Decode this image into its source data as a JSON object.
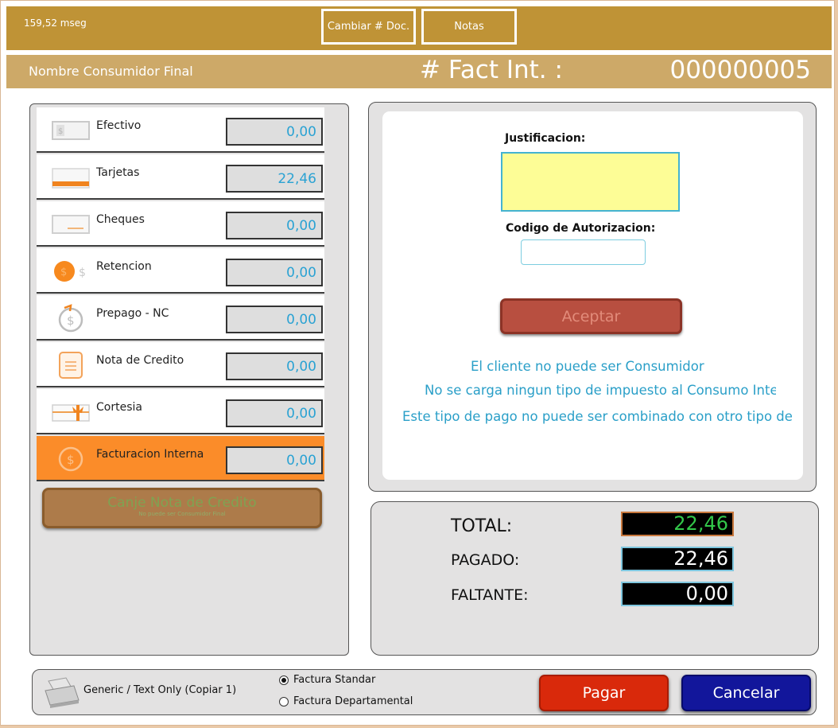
{
  "header": {
    "timing": "159,52 mseg",
    "change_doc_label": "Cambiar # Doc.",
    "notes_label": "Notas"
  },
  "subheader": {
    "consumer_name": "Nombre Consumidor Final",
    "fact_label": "# Fact Int. :",
    "fact_number": "000000005"
  },
  "payments": [
    {
      "label": "Efectivo",
      "value": "0,00",
      "icon": "cash-icon"
    },
    {
      "label": "Tarjetas",
      "value": "22,46",
      "icon": "card-icon"
    },
    {
      "label": "Cheques",
      "value": "0,00",
      "icon": "check-icon"
    },
    {
      "label": "Retencion",
      "value": "0,00",
      "icon": "coin-icon"
    },
    {
      "label": "Prepago - NC",
      "value": "0,00",
      "icon": "refund-icon"
    },
    {
      "label": "Nota de Credito",
      "value": "0,00",
      "icon": "document-icon"
    },
    {
      "label": "Cortesia",
      "value": "0,00",
      "icon": "gift-icon"
    },
    {
      "label": "Facturacion Interna",
      "value": "0,00",
      "icon": "dollar-circle-icon"
    }
  ],
  "canje": {
    "title": "Canje Nota de Credito",
    "subtitle": "No puede ser Consumidor Final"
  },
  "form": {
    "justification_label": "Justificacion:",
    "auth_code_label": "Codigo de Autorizacion:",
    "accept_label": "Aceptar",
    "messages": [
      "El cliente no puede ser Consumidor Fir",
      "No se carga ningun tipo de impuesto al Consumo Internc",
      "Este tipo de pago no puede ser combinado con otro tipo de pa"
    ]
  },
  "totals": {
    "total_label": "TOTAL:",
    "total_value": "22,46",
    "paid_label": "PAGADO:",
    "paid_value": "22,46",
    "missing_label": "FALTANTE:",
    "missing_value": "0,00"
  },
  "footer": {
    "printer_text": "Generic / Text Only (Copiar 1)",
    "radio_standard": "Factura Standar",
    "radio_departmental": "Factura Departamental",
    "pay_label": "Pagar",
    "cancel_label": "Cancelar"
  },
  "colors": {
    "topbar": "#bf9336",
    "subbar": "#cda968",
    "active_row": "#fb8c29",
    "value_text": "#2aa2d3",
    "pay_button": "#d9290b",
    "cancel_button": "#12169b"
  }
}
